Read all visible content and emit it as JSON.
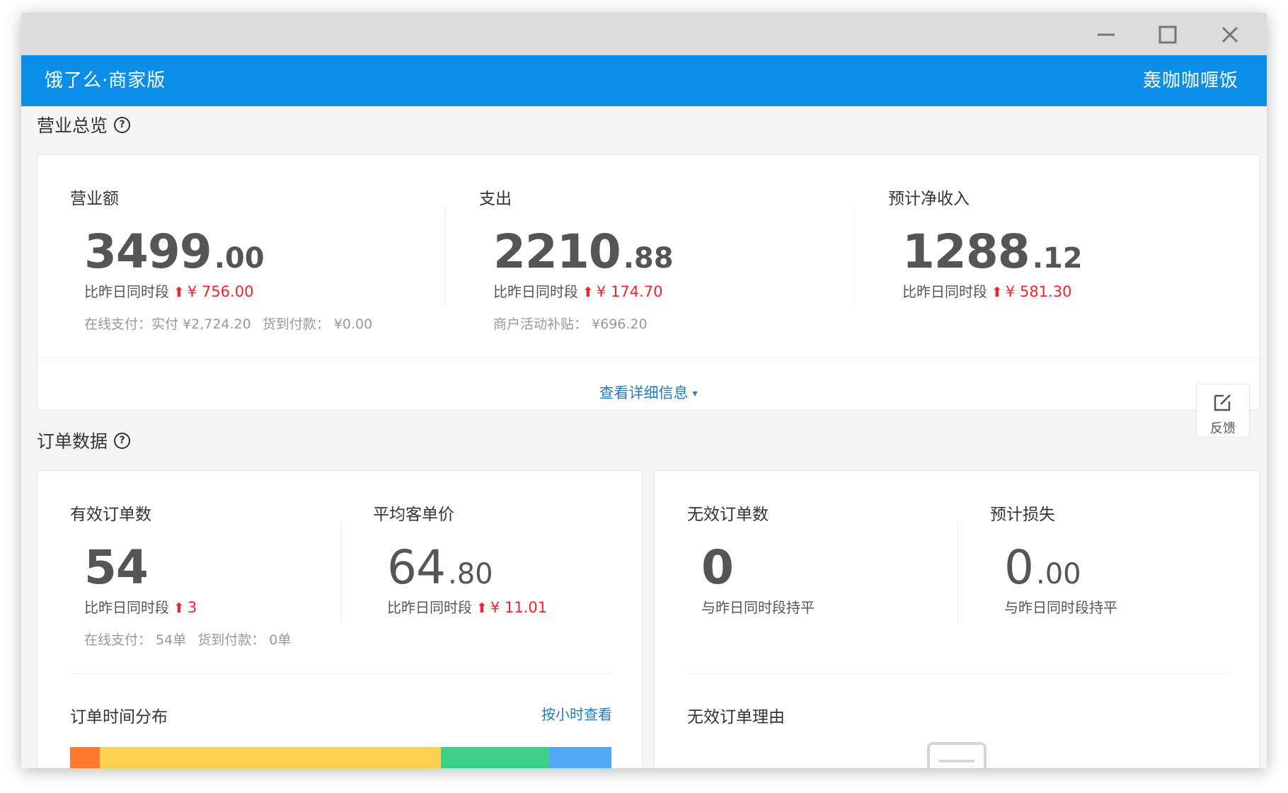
{
  "window_controls": {
    "minimize_icon": "minimize-icon",
    "maximize_icon": "maximize-icon",
    "close_icon": "close-icon"
  },
  "app_bar": {
    "brand": "饿了么·商家版",
    "shop_name": "轰咖咖喱饭",
    "color": "#0a8ee8"
  },
  "overview": {
    "title": "营业总览",
    "metrics": [
      {
        "label": "营业额",
        "int": "3499",
        "dec": ".00",
        "cmp_label": "比昨日同时段",
        "delta": "¥ 756.00",
        "sub": [
          "在线支付：实付 ¥2,724.20",
          "货到付款：  ¥0.00"
        ]
      },
      {
        "label": "支出",
        "int": "2210",
        "dec": ".88",
        "cmp_label": "比昨日同时段",
        "delta": "¥ 174.70",
        "sub": [
          "商户活动补贴：  ¥696.20"
        ]
      },
      {
        "label": "预计净收入",
        "int": "1288",
        "dec": ".12",
        "cmp_label": "比昨日同时段",
        "delta": "¥ 581.30",
        "sub": []
      }
    ],
    "detail_link": "查看详细信息"
  },
  "feedback": {
    "label": "反馈",
    "icon": "edit-icon"
  },
  "orders": {
    "title": "订单数据",
    "valid": {
      "valid_count": {
        "label": "有效订单数",
        "int": "54",
        "dec": "",
        "cmp_label": "比昨日同时段",
        "delta": "3",
        "sub": [
          "在线支付：  54单",
          "货到付款：  0单"
        ]
      },
      "avg_price": {
        "label": "平均客单价",
        "int": "64",
        "dec": ".80",
        "cmp_label": "比昨日同时段",
        "delta": "¥ 11.01"
      },
      "distribution_title": "订单时间分布",
      "hour_link": "按小时查看",
      "distribution_colors": [
        "#ff7a2e",
        "#ffd052",
        "#3ccf8a",
        "#52a8f5"
      ],
      "distribution_shares": [
        0.055,
        0.63,
        0.2,
        0.115
      ]
    },
    "invalid": {
      "invalid_count": {
        "label": "无效订单数",
        "int": "0",
        "dec": "",
        "cmp": "与昨日同时段持平"
      },
      "expected_loss": {
        "label": "预计损失",
        "int": "0",
        "dec": ".00",
        "cmp": "与昨日同时段持平"
      },
      "reason_title": "无效订单理由"
    }
  },
  "colors": {
    "up_red": "#f5222d",
    "link_blue": "#1e7dc8"
  }
}
